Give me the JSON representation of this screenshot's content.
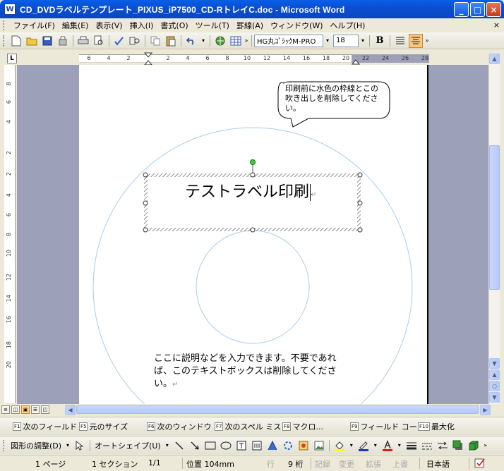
{
  "window": {
    "title": "CD_DVDラベルテンプレート_PIXUS_iP7500_CD-RトレイC.doc - Microsoft Word",
    "minimize": "_",
    "maximize": "□",
    "close": "×"
  },
  "menu": {
    "items": [
      "ファイル(F)",
      "編集(E)",
      "表示(V)",
      "挿入(I)",
      "書式(O)",
      "ツール(T)",
      "罫線(A)",
      "ウィンドウ(W)",
      "ヘルプ(H)"
    ],
    "close_doc": "×"
  },
  "toolbar": {
    "font_name": "HG丸ｺﾞｼｯｸM-PRO",
    "font_size": "18",
    "bold": "B"
  },
  "ruler": {
    "horizontal": [
      "6",
      "4",
      "2",
      "2",
      "4",
      "6",
      "8",
      "10",
      "12",
      "14",
      "16",
      "18",
      "20",
      "22",
      "24",
      "26",
      "28"
    ],
    "vertical": [
      "8",
      "6",
      "4",
      "2",
      "2",
      "4",
      "6",
      "8",
      "10",
      "12",
      "14",
      "16",
      "18",
      "20"
    ],
    "tab_selector": "L"
  },
  "document": {
    "callout_text": "印刷前に水色の枠線とこの吹き出しを削除してください。",
    "title_text": "テストラベル印刷",
    "body_text": "ここに説明などを入力できます。不要であれば、このテキストボックスは削除してください。",
    "paragraph_mark": "↵"
  },
  "function_keys": [
    {
      "key": "F1",
      "label": "次のフィールド"
    },
    {
      "key": "F5",
      "label": "元のサイズ"
    },
    {
      "key": "F6",
      "label": "次のウィンドウ"
    },
    {
      "key": "F7",
      "label": "次のスペル ミス"
    },
    {
      "key": "F8",
      "label": "マクロ..."
    },
    {
      "key": "F9",
      "label": "フィールド コー..."
    },
    {
      "key": "F10",
      "label": "最大化"
    }
  ],
  "drawing": {
    "adjust_label": "図形の調整(D)",
    "autoshape_label": "オートシェイプ(U)"
  },
  "status": {
    "page": "1 ページ",
    "section": "1 セクション",
    "page_of": "1/1",
    "position": "位置 104mm",
    "line_label": "行",
    "column": "9 桁",
    "rec": "記録",
    "trk": "変更",
    "ext": "拡張",
    "ovr": "上書",
    "language": "日本語"
  },
  "colors": {
    "titlebar": "#0a5fe8",
    "circle_guide": "#a8cdea",
    "page_background": "#9ca0b8"
  }
}
